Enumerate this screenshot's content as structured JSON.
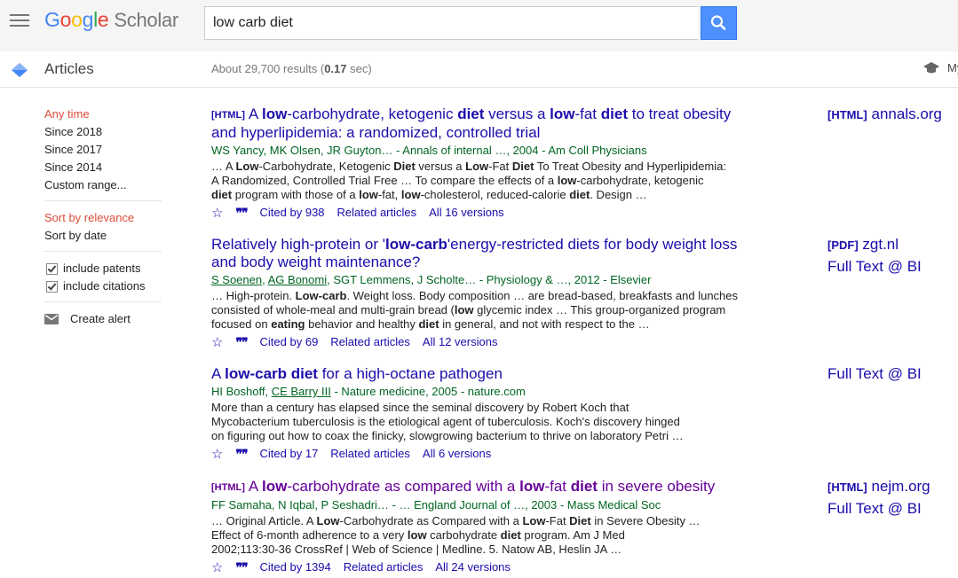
{
  "header": {
    "logo": {
      "g1": "G",
      "o1": "o",
      "o2": "o",
      "g2": "g",
      "l": "l",
      "e": "e",
      "scholar": "Scholar"
    },
    "search_value": "low carb diet"
  },
  "subheader": {
    "section_label": "Articles",
    "results_prefix": "About 29,700 results (",
    "results_time": "0.17",
    "results_suffix": " sec)",
    "my_profile_label": "My profile"
  },
  "sidebar": {
    "time_filters": [
      "Any time",
      "Since 2018",
      "Since 2017",
      "Since 2014",
      "Custom range..."
    ],
    "sort_options": [
      "Sort by relevance",
      "Sort by date"
    ],
    "include_patents": "include patents",
    "include_citations": "include citations",
    "create_alert": "Create alert"
  },
  "results": [
    {
      "tag": "[HTML]",
      "title_html": "A <b>low</b>-carbohydrate, ketogenic <b>diet</b> versus a <b>low</b>-fat <b>diet</b> to treat obesity and hyperlipidemia: a randomized, controlled trial",
      "authors": "WS Yancy, MK Olsen, JR Guyton… - Annals of internal …, 2004 - Am Coll Physicians",
      "snippet_html": "… A <b>Low</b>-Carbohydrate, Ketogenic <b>Diet</b> versus a <b>Low</b>-Fat <b>Diet</b> To Treat Obesity and Hyperlipidemia:<br>A Randomized, Controlled Trial Free … To compare the effects of a <b>low</b>-carbohydrate, ketogenic<br><b>diet</b> program with those of a <b>low</b>-fat, <b>low</b>-cholesterol, reduced-calorie <b>diet</b>. Design …",
      "cited_by": "Cited by 938",
      "related": "Related articles",
      "versions": "All 16 versions",
      "side_tag": "[HTML]",
      "side_source": "annals.org"
    },
    {
      "title_html": "Relatively high-protein or '<b>low-carb</b>'energy-restricted diets for body weight loss and body weight maintenance?",
      "authors_linked": [
        "S Soenen",
        "AG Bonomi"
      ],
      "authors_rest": ", SGT Lemmens, J Scholte… - Physiology & …, 2012 - Elsevier",
      "snippet_html": "… High-protein. <b>Low-carb</b>. Weight loss. Body composition … are bread-based, breakfasts and lunches<br>consisted of whole-meal and multi-grain bread (<b>low</b> glycemic index … This group-organized program<br>focused on <b>eating</b> behavior and healthy <b>diet</b> in general, and not with respect to the …",
      "cited_by": "Cited by 69",
      "related": "Related articles",
      "versions": "All 12 versions",
      "side_tag": "[PDF]",
      "side_source": "zgt.nl",
      "side_fulltext": "Full Text @ BI"
    },
    {
      "title_html": "A <b>low-carb diet</b> for a high-octane pathogen",
      "authors_first": "HI Boshoff, ",
      "authors_linked": [
        "CE Barry III"
      ],
      "authors_rest": " - Nature medicine, 2005 - nature.com",
      "snippet_html": "More than a century has elapsed since the seminal discovery by Robert Koch that<br>Mycobacterium tuberculosis is the etiological agent of tuberculosis. Koch's discovery hinged<br>on figuring out how to coax the finicky, slowgrowing bacterium to thrive on laboratory Petri …",
      "cited_by": "Cited by 17",
      "related": "Related articles",
      "versions": "All 6 versions",
      "side_fulltext": "Full Text @ BI"
    },
    {
      "tag": "[HTML]",
      "title_html": "A <b>low</b>-carbohydrate as compared with a <b>low</b>-fat <b>diet</b> in severe obesity",
      "authors": "FF Samaha, N Iqbal, P Seshadri… - … England Journal of …, 2003 - Mass Medical Soc",
      "snippet_html": "… Original Article. A <b>Low</b>-Carbohydrate as Compared with a <b>Low</b>-Fat <b>Diet</b> in Severe Obesity …<br>Effect of 6-month adherence to a very <b>low</b> carbohydrate <b>diet</b> program. Am J Med<br>2002;113:30-36 CrossRef | Web of Science | Medline. 5. Natow AB, Heslin JA …",
      "cited_by": "Cited by 1394",
      "related": "Related articles",
      "versions": "All 24 versions",
      "side_tag": "[HTML]",
      "side_source": "nejm.org",
      "side_fulltext": "Full Text @ BI"
    }
  ],
  "colors": {
    "link": "#1a0dab",
    "visited": "#660099",
    "green": "#006621",
    "active_filter": "#dd4b39"
  }
}
